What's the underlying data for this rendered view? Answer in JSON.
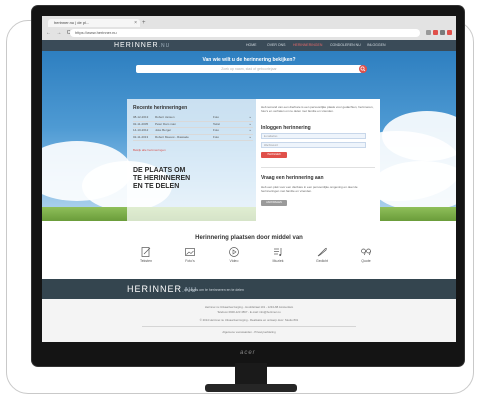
{
  "browser": {
    "tab_title": "herinner.nu | de pl...",
    "tab_close": "×",
    "new_tab": "+",
    "nav_buttons": "← → C",
    "url": "https://www.herinner.nu"
  },
  "site": {
    "logo_main": "HERINNER",
    "logo_suffix": ".NU",
    "menu": [
      "HOME",
      "OVER ONS",
      "HERINNERINGEN",
      "CONDOLEREN NU",
      "INLOGGEN"
    ],
    "active_menu": "HERINNERINGEN"
  },
  "hero": {
    "question": "Van wie wilt u de herinnering bekijken?",
    "search_placeholder": "Zoek op naam, stad of geboortejaar",
    "search_icon": "search-icon"
  },
  "recent": {
    "title": "Recente herinneringen",
    "rows": [
      {
        "date": "08-12-2013",
        "name": "Robert Jansen",
        "type": "Foto",
        "more": "»"
      },
      {
        "date": "02-11-2005",
        "name": "Peter Dam man",
        "type": "Tekst",
        "more": "»"
      },
      {
        "date": "14-10-2012",
        "name": "Joke Berger",
        "type": "Foto",
        "more": "»"
      },
      {
        "date": "02-11-2013",
        "name": "Robert Meeuw - Rawaele",
        "type": "Foto",
        "more": "»"
      }
    ],
    "more_link": "Bekijk alle herinneringen"
  },
  "slogan": [
    "DE PLAATS OM",
    "TE HERINNEREN",
    "EN TE DELEN"
  ],
  "right": {
    "intro": "Heb iemand van een dierbare is een persoonlijke plaats voor gedachten, herinneren, foto's en verhalen om te delen met familie en vrienden.",
    "login_title": "Inloggen herinnering",
    "field1_placeholder": "E-mailadres",
    "field2_placeholder": "Wachtwoord",
    "login_button": "INLOGGEN",
    "request_title": "Vraag een herinnering aan",
    "request_text": "Heb een plek voor een dierbare in een persoonlijke omgeving en deel de herinneringen met familie en vrienden.",
    "request_button": "AANVRAGEN"
  },
  "ways": {
    "title": "Herinnering plaatsen door middel van",
    "items": [
      {
        "label": "Teksten",
        "icon": "pencil-note-icon"
      },
      {
        "label": "Foto's",
        "icon": "photo-icon"
      },
      {
        "label": "Video",
        "icon": "play-icon"
      },
      {
        "label": "Muziek",
        "icon": "music-icon"
      },
      {
        "label": "Gedicht",
        "icon": "quill-icon"
      },
      {
        "label": "Quote",
        "icon": "quote-icon"
      }
    ]
  },
  "footer": {
    "logo_main": "HERINNER",
    "logo_suffix": ".NU",
    "tagline": "de plaats om te herinneren en te delen",
    "info_line1": "Herinner.nu Uitvaartverzorging - Hoofdstraat 101 - 1234 AB Amsterdam",
    "info_line2": "Telefoon 0900-123 4567 - E-mail: info@herinner.nu",
    "info_line3": "© 2014 Herinner.nu Uitvaartverzorging - Realisatie en ontwerp door: Studio 801",
    "info_line4": "Algemene voorwaarden - Privacyverklaring"
  },
  "monitor": {
    "brand": "acer"
  },
  "colors": {
    "nav": "#3a4b58",
    "accent_red": "#e0504a",
    "footer_band": "#34454f"
  }
}
